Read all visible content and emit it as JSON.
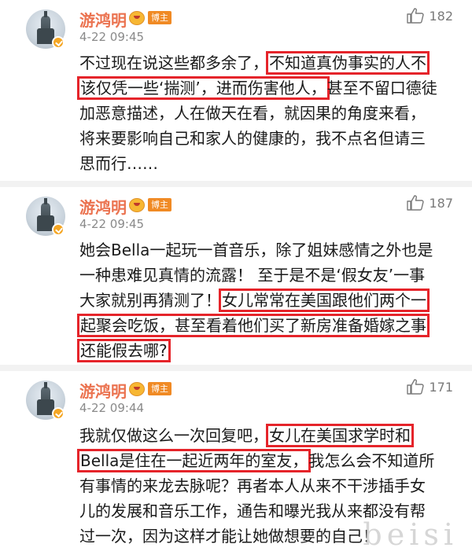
{
  "comments": [
    {
      "author": "游鸿明",
      "badge": "博主",
      "time": "4-22 09:45",
      "likes": "182",
      "lines": [
        [
          {
            "t": "不过现在说这些都多余了，",
            "h": false
          },
          {
            "t": "不知道真伪事实的人不",
            "h": true
          }
        ],
        [
          {
            "t": "该仅凭一些‘揣测’，进而伤害他人，",
            "h": true
          },
          {
            "t": "甚至不留口德徒",
            "h": false
          }
        ],
        [
          {
            "t": "加恶意描述，人在做天在看，就因果的角度来看，",
            "h": false
          }
        ],
        [
          {
            "t": "将来要影响自己和家人的健康的，我不点名但请三",
            "h": false
          }
        ],
        [
          {
            "t": "思而行……",
            "h": false
          }
        ]
      ]
    },
    {
      "author": "游鸿明",
      "badge": "博主",
      "time": "4-22 09:45",
      "likes": "187",
      "lines": [
        [
          {
            "t": "她会Bella一起玩一首音乐，除了姐妹感情之外也是",
            "h": false
          }
        ],
        [
          {
            "t": "一种患难见真情的流露！ 至于是不是‘假女友’一事",
            "h": false
          }
        ],
        [
          {
            "t": "大家就别再猜测了！",
            "h": false
          },
          {
            "t": "女儿常常在美国跟他们两个一",
            "h": true
          }
        ],
        [
          {
            "t": "起聚会吃饭，甚至看着他们买了新房准备婚嫁之事",
            "h": true
          }
        ],
        [
          {
            "t": "还能假去哪?",
            "h": true
          }
        ]
      ]
    },
    {
      "author": "游鸿明",
      "badge": "博主",
      "time": "4-22 09:44",
      "likes": "171",
      "lines": [
        [
          {
            "t": "我就仅做这么一次回复吧，",
            "h": false
          },
          {
            "t": "女儿在美国求学时和",
            "h": true
          }
        ],
        [
          {
            "t": "Bella是住在一起近两年的室友，",
            "h": true
          },
          {
            "t": "我怎么会不知道所",
            "h": false
          }
        ],
        [
          {
            "t": "有事情的来龙去脉呢？再者本人从来不干涉插手女",
            "h": false
          }
        ],
        [
          {
            "t": "儿的发展和音乐工作，通告和曝光我从来都没有帮",
            "h": false
          }
        ],
        [
          {
            "t": "过一次，因为这样才能让她做想要的自己！",
            "h": false
          }
        ]
      ]
    }
  ],
  "watermark": "beisi",
  "colors": {
    "name": "#eb7350",
    "highlight": "#e5242a",
    "badge": "#f08a24"
  }
}
